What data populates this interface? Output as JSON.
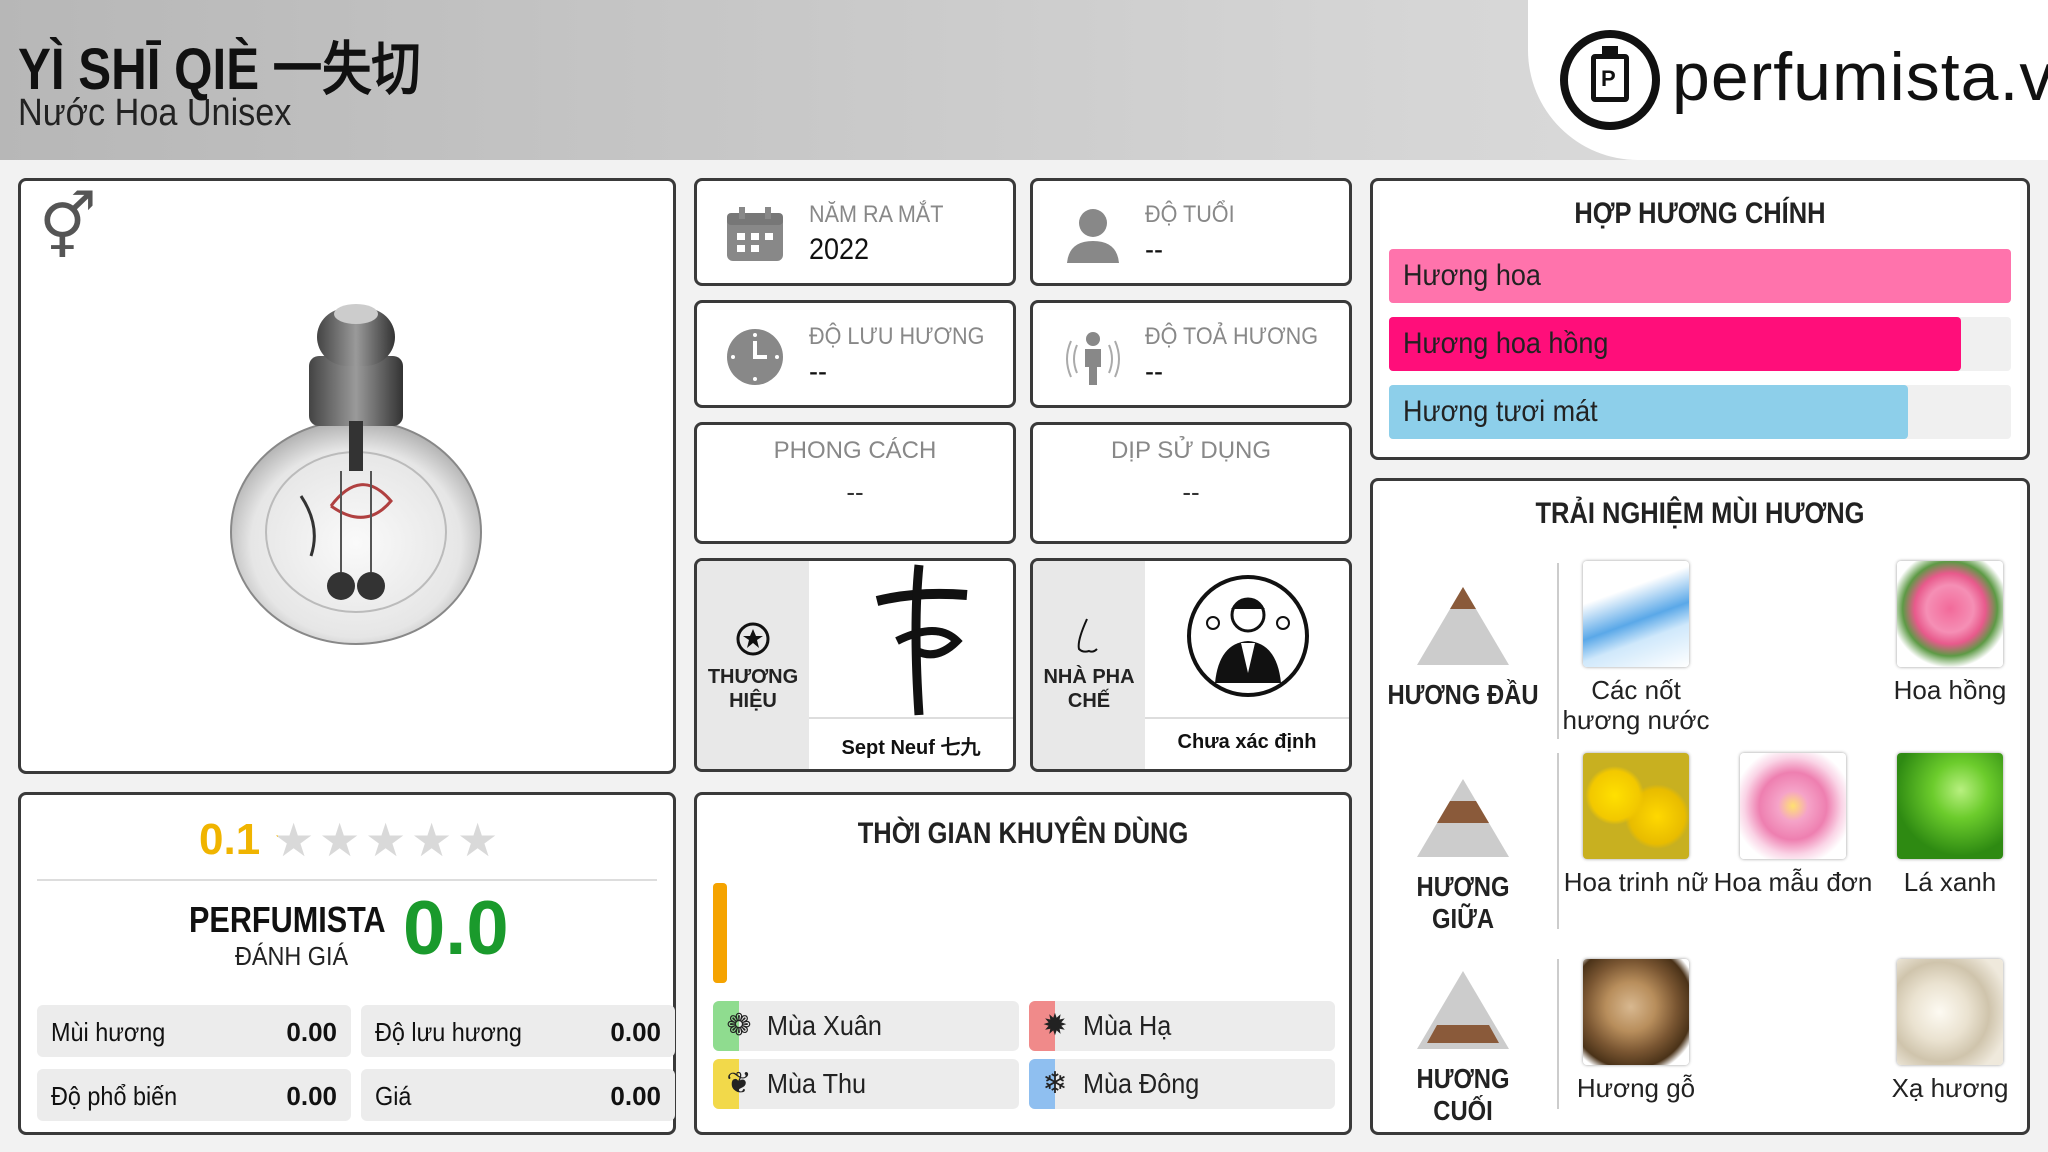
{
  "header": {
    "title": "YÌ SHĪ QIÈ 一失切",
    "subtitle": "Nước Hoa Unisex",
    "logo": "perfumista.vn"
  },
  "stats": {
    "release": {
      "label": "NĂM RA MẮT",
      "value": "2022"
    },
    "age": {
      "label": "ĐỘ TUỔI",
      "value": "--"
    },
    "longevity": {
      "label": "ĐỘ LƯU HƯƠNG",
      "value": "--"
    },
    "sillage": {
      "label": "ĐỘ TOẢ HƯƠNG",
      "value": "--"
    },
    "style": {
      "label": "PHONG CÁCH",
      "value": "--"
    },
    "occasion": {
      "label": "DỊP SỬ DỤNG",
      "value": "--"
    }
  },
  "brand": {
    "label_line1": "THƯƠNG",
    "label_line2": "HIỆU",
    "name": "Sept Neuf 七九"
  },
  "perfumer": {
    "label_line1": "NHÀ PHA",
    "label_line2": "CHẾ",
    "name": "Chưa xác định"
  },
  "rating": {
    "score": "0.1",
    "stars": 0.02,
    "brand_line1": "PERFUMISTA",
    "brand_line2": "ĐÁNH GIÁ",
    "perfumista_score": "0.0",
    "items": [
      {
        "label": "Mùi hương",
        "value": "0.00"
      },
      {
        "label": "Độ lưu hương",
        "value": "0.00"
      },
      {
        "label": "Độ phổ biến",
        "value": "0.00"
      },
      {
        "label": "Giá",
        "value": "0.00"
      }
    ]
  },
  "timing": {
    "title": "THỜI GIAN KHUYÊN DÙNG",
    "day_level": 1.0,
    "seasons": [
      {
        "label": "Mùa Xuân",
        "color": "#8fdc8f",
        "icon": "flower-icon"
      },
      {
        "label": "Mùa Hạ",
        "color": "#f08a8a",
        "icon": "sun-icon"
      },
      {
        "label": "Mùa Thu",
        "color": "#f2d94a",
        "icon": "leaf-icon"
      },
      {
        "label": "Mùa Đông",
        "color": "#8fbff0",
        "icon": "snowflake-icon"
      }
    ]
  },
  "accords": {
    "title": "HỢP HƯƠNG CHÍNH",
    "items": [
      {
        "label": "Hương hoa",
        "level": 1.0,
        "color": "#ff73ac"
      },
      {
        "label": "Hương hoa hồng",
        "level": 0.92,
        "color": "#ff0e7a"
      },
      {
        "label": "Hương tươi mát",
        "level": 0.835,
        "color": "#8dcfea"
      }
    ]
  },
  "notes": {
    "title": "TRẢI NGHIỆM MÙI HƯƠNG",
    "top": {
      "label": "HƯƠNG ĐẦU",
      "items": [
        "Các nốt hương nước",
        "Hoa hồng"
      ]
    },
    "middle": {
      "label": "HƯƠNG GIỮA",
      "items": [
        "Hoa trinh nữ",
        "Hoa mẫu đơn",
        "Lá xanh"
      ]
    },
    "base": {
      "label": "HƯƠNG CUỐI",
      "items": [
        "Hương gỗ",
        "Xạ hương"
      ]
    }
  }
}
